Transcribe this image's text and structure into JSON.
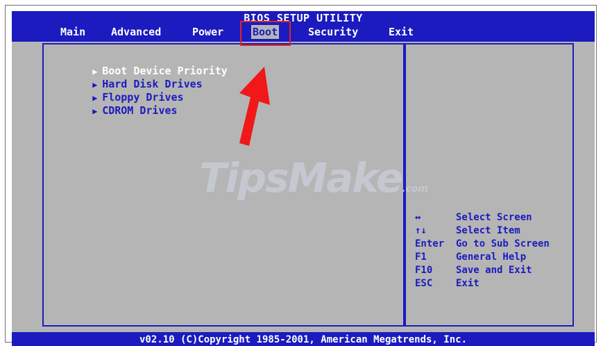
{
  "header": {
    "title": "BIOS SETUP UTILITY",
    "tabs": [
      "Main",
      "Advanced",
      "Power",
      "Boot",
      "Security",
      "Exit"
    ],
    "active_tab": "Boot"
  },
  "menu": {
    "items": [
      "Boot Device Priority",
      "Hard Disk Drives",
      "Floppy Drives",
      "CDROM Drives"
    ],
    "selected_index": 0
  },
  "help": {
    "rows": [
      {
        "key": "↔",
        "desc": "Select Screen"
      },
      {
        "key": "↑↓",
        "desc": "Select Item"
      },
      {
        "key": "Enter",
        "desc": "Go to Sub Screen"
      },
      {
        "key": "F1",
        "desc": "General Help"
      },
      {
        "key": "F10",
        "desc": "Save and Exit"
      },
      {
        "key": "ESC",
        "desc": "Exit"
      }
    ]
  },
  "footer": {
    "copyright": "v02.10 (C)Copyright 1985-2001, American Megatrends, Inc."
  },
  "watermark": {
    "text": "TipsMake",
    "suffix": ".com"
  },
  "colors": {
    "bios_blue": "#1b1bbf",
    "bios_gray": "#b5b5b5",
    "annotation_red": "#e12424"
  },
  "annotation_icon": "red-arrow-icon"
}
